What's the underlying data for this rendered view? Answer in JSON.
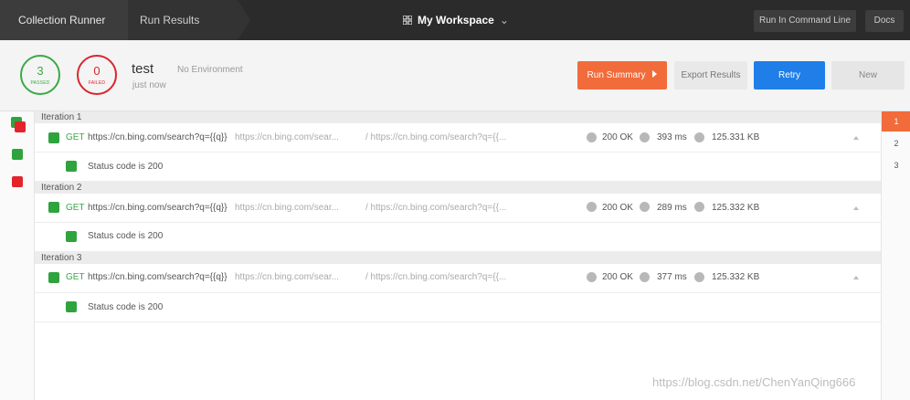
{
  "topbar": {
    "crumb_runner": "Collection Runner",
    "crumb_results": "Run Results",
    "workspace": "My Workspace",
    "cmd_button": "Run In Command Line",
    "docs_button": "Docs"
  },
  "summary": {
    "passed_count": "3",
    "passed_label": "PASSED",
    "failed_count": "0",
    "failed_label": "FAILED",
    "run_name": "test",
    "run_time": "just now",
    "environment": "No Environment",
    "run_summary_button": "Run Summary",
    "export_button": "Export Results",
    "retry_button": "Retry",
    "new_button": "New"
  },
  "pages": [
    "1",
    "2",
    "3"
  ],
  "iterations": [
    {
      "title": "Iteration 1",
      "method": "GET",
      "url": "https://cn.bing.com/search?q={{q}}",
      "resolved_url": "https://cn.bing.com/sear...",
      "path": "/ https://cn.bing.com/search?q={{...",
      "status": "200 OK",
      "time": "393 ms",
      "size": "125.331 KB",
      "test": "Status code is 200"
    },
    {
      "title": "Iteration 2",
      "method": "GET",
      "url": "https://cn.bing.com/search?q={{q}}",
      "resolved_url": "https://cn.bing.com/sear...",
      "path": "/ https://cn.bing.com/search?q={{...",
      "status": "200 OK",
      "time": "289 ms",
      "size": "125.332 KB",
      "test": "Status code is 200"
    },
    {
      "title": "Iteration 3",
      "method": "GET",
      "url": "https://cn.bing.com/search?q={{q}}",
      "resolved_url": "https://cn.bing.com/sear...",
      "path": "/ https://cn.bing.com/search?q={{...",
      "status": "200 OK",
      "time": "377 ms",
      "size": "125.332 KB",
      "test": "Status code is 200"
    }
  ],
  "watermark": "https://blog.csdn.net/ChenYanQing666",
  "colors": {
    "pass": "#3aa945",
    "fail": "#d9262e",
    "accent": "#f26b3a",
    "primary": "#1f7ee8"
  },
  "icons": {
    "workspace": "grid-icon",
    "dropdown": "chevron-down-icon",
    "run_summary": "play-arrow-icon",
    "collapse": "caret-up-icon"
  }
}
